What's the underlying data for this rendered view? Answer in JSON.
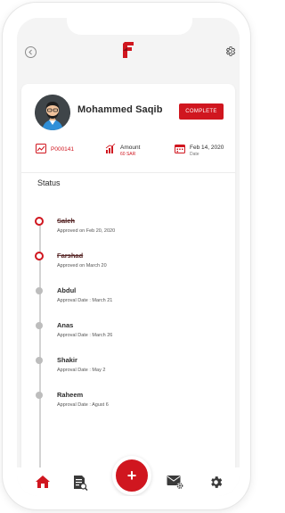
{
  "colors": {
    "accent": "#d0161f",
    "text": "#2b2b2b",
    "muted": "#555555",
    "background": "#f4f4f4"
  },
  "header": {
    "back_icon": "back-circle-icon",
    "logo_icon": "brand-logo-icon",
    "settings_icon": "gear-icon"
  },
  "profile": {
    "name": "Mohammed Saqib",
    "status_button": "COMPLETE"
  },
  "info": {
    "order_id": "P000141",
    "amount_label": "Amount",
    "amount_value": "60 SAR",
    "date_value": "Feb 14, 2020",
    "date_label": "Date"
  },
  "status": {
    "title": "Status",
    "items": [
      {
        "name": "Saleh",
        "detail": "Approved on Feb 20, 2020",
        "done": true
      },
      {
        "name": "Farshad",
        "detail": "Approved on March 20",
        "done": true
      },
      {
        "name": "Abdul",
        "detail": "Approval Date : March 21",
        "done": false
      },
      {
        "name": "Anas",
        "detail": "Approval Date : March 26",
        "done": false
      },
      {
        "name": "Shakir",
        "detail": "Approval Date : May 2",
        "done": false
      },
      {
        "name": "Raheem",
        "detail": "Approval Date : Agust 6",
        "done": false
      }
    ]
  },
  "bottom_nav": {
    "home_icon": "home-icon",
    "documents_icon": "document-search-icon",
    "add_label": "+",
    "mail_settings_icon": "mail-settings-icon",
    "settings_icon": "gear-icon"
  }
}
